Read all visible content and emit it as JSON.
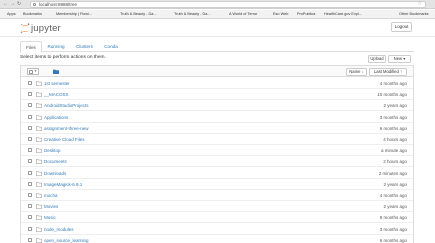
{
  "browser": {
    "url": "localhost:8888/tree",
    "bookmarks": [
      {
        "label": "Apps",
        "color": "#6d6d6d"
      },
      {
        "label": "Bookmarks",
        "color": "#8a8a8a"
      },
      {
        "label": "Membership | Flowi...",
        "color": "#d9534f"
      },
      {
        "label": "Truth & Beauty - Da...",
        "color": "#5b9bd5"
      },
      {
        "label": "Truth & Beauty - Da...",
        "color": "#5b9bd5"
      },
      {
        "label": "A World of Terror",
        "color": "#c0392b"
      },
      {
        "label": "Eso Web",
        "color": "#f0ad4e"
      },
      {
        "label": "ProPublica",
        "color": "#333333"
      },
      {
        "label": "HealthCare.gov Expl...",
        "color": "#2e86c1"
      },
      {
        "label": "Other Bookmarks",
        "color": "#8a8a8a"
      }
    ]
  },
  "header": {
    "logo_text": "jupyter",
    "logout_label": "Logout"
  },
  "tabs": [
    {
      "label": "Files",
      "active": true
    },
    {
      "label": "Running",
      "active": false
    },
    {
      "label": "Clusters",
      "active": false
    },
    {
      "label": "Conda",
      "active": false
    }
  ],
  "toolbar": {
    "hint": "Select items to perform actions on them.",
    "upload_label": "Upload",
    "new_label": "New ▾",
    "sort_name_label": "Name ↓",
    "sort_modified_label": "Last Modified ↑",
    "breadcrumb_root": "0"
  },
  "files": [
    {
      "name": "1st semester",
      "modified": "4 months ago"
    },
    {
      "name": "__MACOSX",
      "modified": "10 months ago"
    },
    {
      "name": "AndroidStudioProjects",
      "modified": "2 years ago"
    },
    {
      "name": "Applications",
      "modified": "3 months ago"
    },
    {
      "name": "assignment-three-new",
      "modified": "6 months ago"
    },
    {
      "name": "Creative Cloud Files",
      "modified": "4 hours ago"
    },
    {
      "name": "Desktop",
      "modified": "a minute ago"
    },
    {
      "name": "Documents",
      "modified": "2 hours ago"
    },
    {
      "name": "Downloads",
      "modified": "2 minutes ago"
    },
    {
      "name": "ImageMagick-6.9.1",
      "modified": "2 years ago"
    },
    {
      "name": "mocha",
      "modified": "4 months ago"
    },
    {
      "name": "Movies",
      "modified": "2 years ago"
    },
    {
      "name": "Music",
      "modified": "8 months ago"
    },
    {
      "name": "node_modules",
      "modified": "3 months ago"
    },
    {
      "name": "open_source_learning",
      "modified": "6 months ago"
    }
  ],
  "colors": {
    "link": "#337ab7",
    "folder": "#9a9a9a",
    "logo_orange": "#f37726"
  }
}
